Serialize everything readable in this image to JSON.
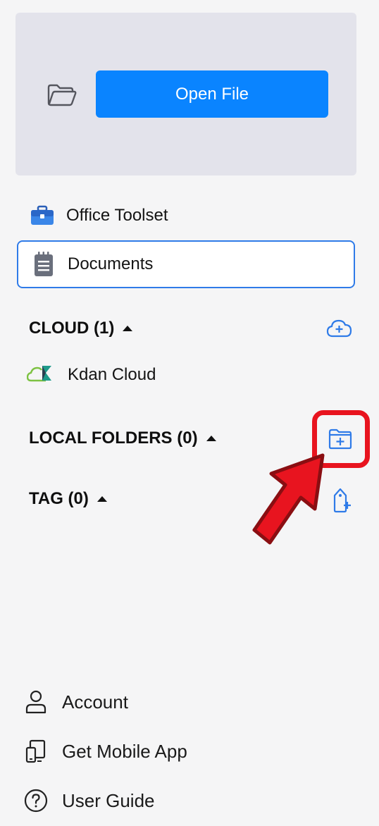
{
  "open_panel": {
    "button_label": "Open File"
  },
  "nav": {
    "items": [
      {
        "label": "Office Toolset",
        "icon": "toolbox-icon"
      },
      {
        "label": "Documents",
        "icon": "notepad-icon",
        "selected": true
      }
    ]
  },
  "sections": {
    "cloud": {
      "title": "CLOUD (1)",
      "action_icon": "cloud-add-icon",
      "items": [
        {
          "label": "Kdan Cloud",
          "icon": "kdan-cloud-icon"
        }
      ]
    },
    "local_folders": {
      "title": "LOCAL FOLDERS (0)",
      "action_icon": "folder-add-icon"
    },
    "tag": {
      "title": "TAG (0)",
      "action_icon": "tag-add-icon"
    }
  },
  "footer": {
    "items": [
      {
        "label": "Account",
        "icon": "user-icon"
      },
      {
        "label": "Get Mobile App",
        "icon": "mobile-app-icon"
      },
      {
        "label": "User Guide",
        "icon": "help-icon"
      }
    ]
  },
  "colors": {
    "accent": "#0a84ff",
    "panel_bg": "#e3e3eb",
    "sidebar_bg": "#f5f5f6",
    "highlight": "#e8141f",
    "icon_blue": "#2f7be8"
  }
}
